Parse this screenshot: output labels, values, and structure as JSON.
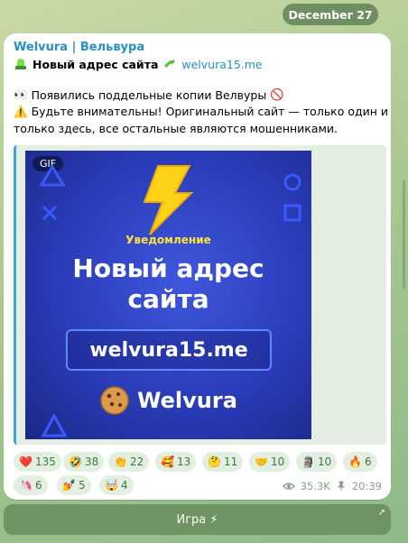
{
  "date": "December 27",
  "post": {
    "channel": "Welvura | Вельвура",
    "title": "Новый адрес сайта",
    "link": "welvura15.me",
    "line1": "Появились поддельные копии Велвуры",
    "line2": "Будьте внимательны! Оригинальный сайт — только один и",
    "line3": "только здесь, все остальные являются мошенниками.",
    "media": {
      "badge": "GIF",
      "notice": "Уведомление",
      "headline1": "Новый адрес",
      "headline2": "сайта",
      "url": "welvura15.me",
      "brand": "Welvura"
    }
  },
  "reactions": [
    {
      "emoji": "❤️",
      "count": "135"
    },
    {
      "emoji": "🤣",
      "count": "38"
    },
    {
      "emoji": "👏",
      "count": "22"
    },
    {
      "emoji": "🥰",
      "count": "13"
    },
    {
      "emoji": "🤔",
      "count": "11"
    },
    {
      "emoji": "🤝",
      "count": "10"
    },
    {
      "emoji": "🗿",
      "count": "10"
    },
    {
      "emoji": "🔥",
      "count": "6"
    },
    {
      "emoji": "🦄",
      "count": "6"
    },
    {
      "emoji": "💅",
      "count": "5"
    },
    {
      "emoji": "🤯",
      "count": "4"
    }
  ],
  "meta": {
    "views": "35.3K",
    "time": "20:39"
  },
  "keyboard": {
    "button": "Игра ⚡"
  }
}
